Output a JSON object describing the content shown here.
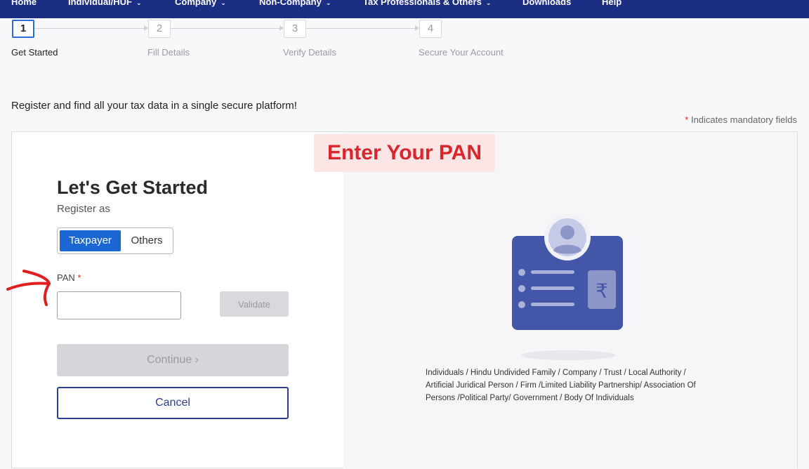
{
  "nav": {
    "items": [
      {
        "label": "Home",
        "dropdown": false
      },
      {
        "label": "Individual/HUF",
        "dropdown": true
      },
      {
        "label": "Company",
        "dropdown": true
      },
      {
        "label": "Non-Company",
        "dropdown": true
      },
      {
        "label": "Tax Professionals & Others",
        "dropdown": true
      },
      {
        "label": "Downloads",
        "dropdown": false
      },
      {
        "label": "Help",
        "dropdown": false
      }
    ]
  },
  "stepper": {
    "steps": [
      {
        "number": "1",
        "label": "Get Started",
        "active": true
      },
      {
        "number": "2",
        "label": "Fill Details",
        "active": false
      },
      {
        "number": "3",
        "label": "Verify Details",
        "active": false
      },
      {
        "number": "4",
        "label": "Secure Your Account",
        "active": false
      }
    ]
  },
  "tagline": "Register and find all your tax data in a single secure platform!",
  "mandatory": {
    "star": "*",
    "text": "Indicates mandatory fields"
  },
  "banner": "Enter Your PAN",
  "form": {
    "title": "Let's Get Started",
    "subtitle": "Register as",
    "toggle": {
      "selected": "Taxpayer",
      "other": "Others"
    },
    "pan_label": "PAN",
    "pan_required": "*",
    "pan_value": "",
    "validate_label": "Validate",
    "continue_label": "Continue ›",
    "cancel_label": "Cancel"
  },
  "entity_text": "Individuals / Hindu Undivided Family / Company / Trust / Local Authority / Artificial Juridical Person / Firm /Limited Liability Partnership/ Association Of Persons /Political Party/ Government / Body Of Individuals",
  "colors": {
    "nav_bg": "#1c2e84",
    "primary": "#1a66d3",
    "banner_text": "#d8262c",
    "banner_bg": "#fbe6e5",
    "illustration": "#4356a8"
  }
}
